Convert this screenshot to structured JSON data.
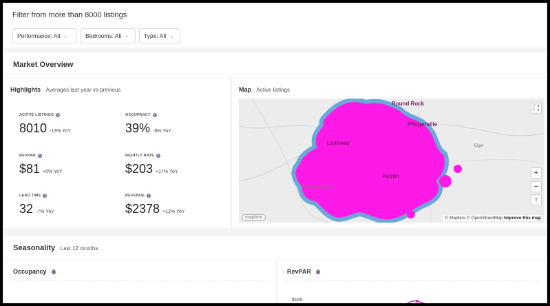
{
  "filters": {
    "title": "Filter from more than 8000 listings",
    "performance": "Performance: All",
    "bedrooms": "Bedrooms: All",
    "type": "Type: All"
  },
  "overview": {
    "title": "Market Overview"
  },
  "highlights": {
    "title": "Highlights",
    "subtitle": "Averages last year vs previous",
    "metrics": [
      {
        "label": "ACTIVE LISTINGS",
        "value": "8010",
        "yoy": "-13% YoY"
      },
      {
        "label": "OCCUPANCY",
        "value": "39%",
        "yoy": "-8% YoY"
      },
      {
        "label": "REVPAR",
        "value": "$81",
        "yoy": "+5% YoY"
      },
      {
        "label": "NIGHTLY RATE",
        "value": "$203",
        "yoy": "+17% YoY"
      },
      {
        "label": "LEAD TIME",
        "value": "32",
        "yoy": "-7% YoY"
      },
      {
        "label": "REVENUE",
        "value": "$2378",
        "yoy": "+12% YoY"
      }
    ]
  },
  "map": {
    "title": "Map",
    "subtitle": "Active listings",
    "attribution_mapbox": "© Mapbox",
    "attribution_osm": "© OpenStreetMap",
    "attribution_improve": "Improve this map",
    "logo": "mapbox",
    "places": [
      "Round Rock",
      "Pflugerville",
      "Austin",
      "Dripping Springs",
      "Elgin",
      "Lakeway"
    ],
    "zoom_in": "+",
    "zoom_out": "−",
    "compass": "↑",
    "fullscreen": "⛶",
    "highlight_color": "#ff19e6",
    "border_color": "#6aa8d8"
  },
  "seasonality": {
    "title": "Seasonality",
    "subtitle": "Last 12 months"
  },
  "occupancy_chart": {
    "title": "Occupancy"
  },
  "revpar_chart": {
    "title": "RevPAR",
    "y_tick": "$100"
  }
}
